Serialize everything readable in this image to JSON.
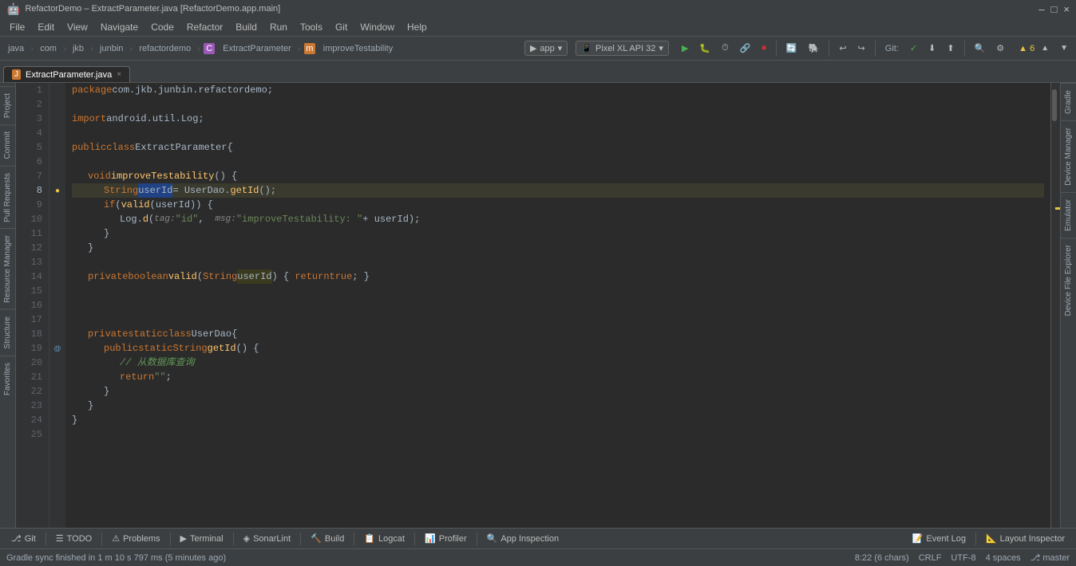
{
  "titleBar": {
    "title": "RefactorDemo – ExtractParameter.java [RefactorDemo.app.main]",
    "controls": [
      "–",
      "□",
      "×"
    ]
  },
  "menuBar": {
    "items": [
      "File",
      "Edit",
      "View",
      "Navigate",
      "Code",
      "Refactor",
      "Build",
      "Run",
      "Tools",
      "Git",
      "Window",
      "Help"
    ]
  },
  "toolbar": {
    "breadcrumb": [
      "java",
      "com",
      "jkb",
      "junbin",
      "refactordemo",
      "ExtractParameter",
      "improveTestability"
    ],
    "appDropdown": "app",
    "deviceDropdown": "Pixel XL API 32",
    "warningCount": "▲ 6"
  },
  "tabs": [
    {
      "label": "ExtractParameter.java",
      "active": true,
      "icon": "J"
    }
  ],
  "code": {
    "lines": [
      {
        "num": 1,
        "text": "package com.jkb.junbin.refactordemo;",
        "highlight": false
      },
      {
        "num": 2,
        "text": "",
        "highlight": false
      },
      {
        "num": 3,
        "text": "import android.util.Log;",
        "highlight": false
      },
      {
        "num": 4,
        "text": "",
        "highlight": false
      },
      {
        "num": 5,
        "text": "public class ExtractParameter {",
        "highlight": false
      },
      {
        "num": 6,
        "text": "",
        "highlight": false
      },
      {
        "num": 7,
        "text": "    void improveTestability() {",
        "highlight": false
      },
      {
        "num": 8,
        "text": "        String userId = UserDao.getId();",
        "highlight": true,
        "hasBreakpoint": true,
        "hasDot": true
      },
      {
        "num": 9,
        "text": "        if (valid(userId)) {",
        "highlight": false
      },
      {
        "num": 10,
        "text": "            Log.d(tag: \"id\",  msg: \"improveTestability: \" + userId);",
        "highlight": false
      },
      {
        "num": 11,
        "text": "        }",
        "highlight": false
      },
      {
        "num": 12,
        "text": "    }",
        "highlight": false
      },
      {
        "num": 13,
        "text": "",
        "highlight": false
      },
      {
        "num": 14,
        "text": "    private boolean valid(String userId) { return true; }",
        "highlight": false
      },
      {
        "num": 15,
        "text": "",
        "highlight": false
      },
      {
        "num": 16,
        "text": "",
        "highlight": false
      },
      {
        "num": 17,
        "text": "",
        "highlight": false
      },
      {
        "num": 18,
        "text": "    private static class UserDao {",
        "highlight": false
      },
      {
        "num": 19,
        "text": "        public static String getId() {",
        "highlight": false,
        "hasOverride": true
      },
      {
        "num": 20,
        "text": "            // 从数据库查询",
        "highlight": false
      },
      {
        "num": 21,
        "text": "            return \"\";",
        "highlight": false
      },
      {
        "num": 22,
        "text": "        }",
        "highlight": false
      },
      {
        "num": 23,
        "text": "    }",
        "highlight": false
      },
      {
        "num": 24,
        "text": "}",
        "highlight": false
      },
      {
        "num": 25,
        "text": "",
        "highlight": false
      }
    ]
  },
  "bottomTools": [
    {
      "icon": "⎇",
      "label": "Git"
    },
    {
      "icon": "☰",
      "label": "TODO"
    },
    {
      "icon": "⚠",
      "label": "Problems"
    },
    {
      "icon": "▶",
      "label": "Terminal"
    },
    {
      "icon": "◈",
      "label": "SonarLint"
    },
    {
      "icon": "🔨",
      "label": "Build"
    },
    {
      "icon": "📋",
      "label": "Logcat"
    },
    {
      "icon": "📊",
      "label": "Profiler"
    },
    {
      "icon": "🔍",
      "label": "App Inspection"
    }
  ],
  "bottomToolsRight": [
    {
      "icon": "📝",
      "label": "Event Log"
    },
    {
      "icon": "📐",
      "label": "Layout Inspector"
    }
  ],
  "statusBar": {
    "message": "Gradle sync finished in 1 m 10 s 797 ms (5 minutes ago)",
    "position": "8:22 (6 chars)",
    "encoding": "CRLF",
    "charset": "UTF-8",
    "indent": "4 spaces",
    "branch": "master"
  },
  "rightPanels": [
    "Gradle",
    "Device Manager",
    "Emulator",
    "Device File Explorer"
  ],
  "leftPanels": [
    "Project",
    "Commit",
    "Pull Requests",
    "Resource Manager",
    "Structure",
    "Favorites"
  ]
}
